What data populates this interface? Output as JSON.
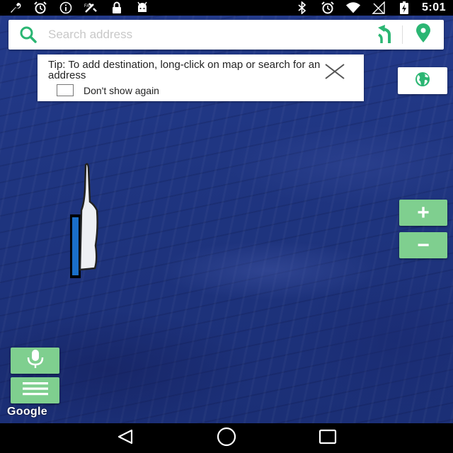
{
  "status_bar": {
    "time": "5:01",
    "left_icons": [
      "wrench-icon",
      "alarm-icon",
      "info-icon",
      "fax-icon",
      "lock-icon",
      "android-icon"
    ],
    "right_icons": [
      "bluetooth-icon",
      "alarm-icon",
      "wifi-icon",
      "signal-icon",
      "battery-icon"
    ]
  },
  "search": {
    "placeholder": "Search address",
    "icons": [
      "search-icon",
      "route-icon",
      "location-pin-icon"
    ]
  },
  "tip": {
    "text": "Tip: To add destination, long-click on map or search for an address",
    "checkbox_label": "Don't show again",
    "checked": false
  },
  "map": {
    "globe_icon": "globe-icon",
    "zoom_in_label": "+",
    "zoom_out_label": "−",
    "attribution": "Google"
  },
  "colors": {
    "accent_green": "#7fcf8f",
    "ocean_blue": "#1f3580",
    "icon_green": "#2bb673"
  },
  "nav_bar": {
    "icons": [
      "back-icon",
      "home-icon",
      "recents-icon"
    ]
  }
}
